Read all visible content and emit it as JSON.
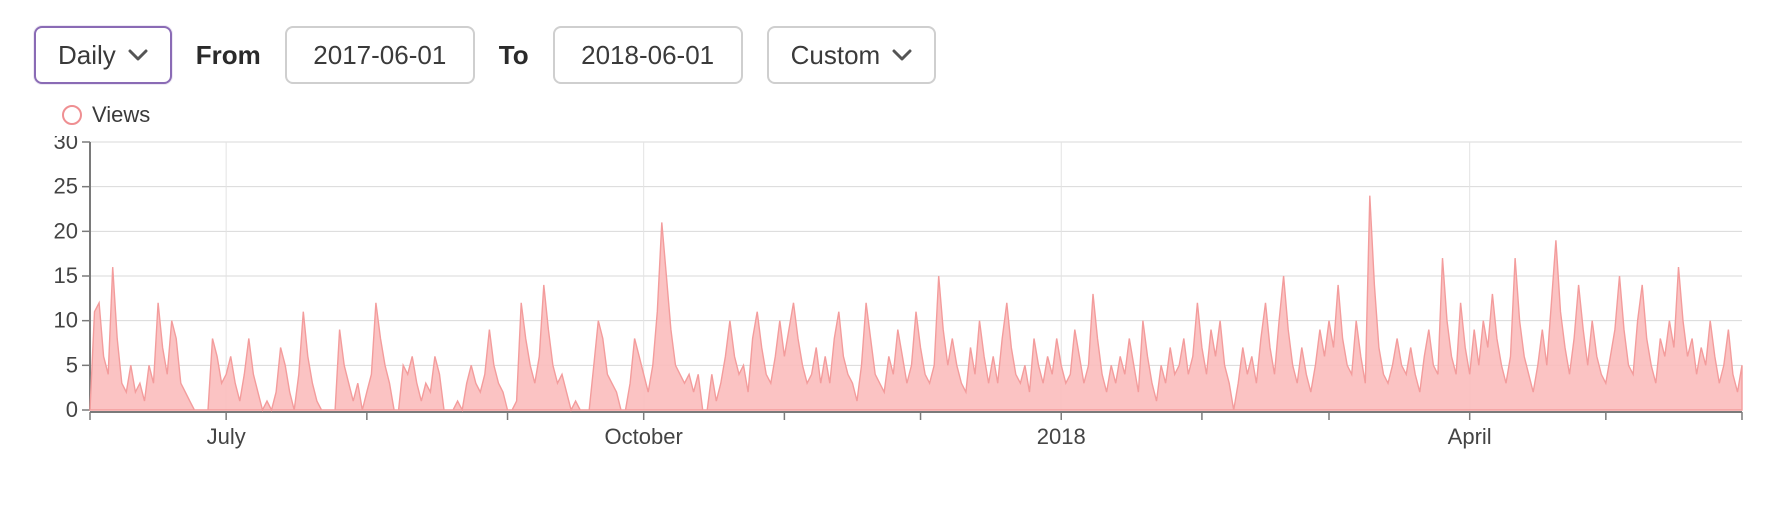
{
  "toolbar": {
    "granularity": "Daily",
    "from_label": "From",
    "from_value": "2017-06-01",
    "to_label": "To",
    "to_value": "2018-06-01",
    "range_preset": "Custom"
  },
  "legend": {
    "series_label": "Views"
  },
  "chart_data": {
    "type": "area",
    "title": "",
    "xlabel": "",
    "ylabel": "",
    "ylim": [
      0,
      30
    ],
    "yticks": [
      0,
      5,
      10,
      15,
      20,
      25,
      30
    ],
    "x_tick_labels": [
      "July",
      "October",
      "2018",
      "April"
    ],
    "series": [
      {
        "name": "Views",
        "start_date": "2017-06-01",
        "end_date": "2018-06-01",
        "color": "#fbbdbc",
        "stroke": "#f39c9c",
        "values": [
          0,
          11,
          12,
          6,
          4,
          16,
          8,
          3,
          2,
          5,
          2,
          3,
          1,
          5,
          3,
          12,
          7,
          4,
          10,
          8,
          3,
          2,
          1,
          0,
          0,
          0,
          0,
          8,
          6,
          3,
          4,
          6,
          3,
          1,
          4,
          8,
          4,
          2,
          0,
          1,
          0,
          2,
          7,
          5,
          2,
          0,
          4,
          11,
          6,
          3,
          1,
          0,
          0,
          0,
          0,
          9,
          5,
          3,
          1,
          3,
          0,
          2,
          4,
          12,
          8,
          5,
          3,
          0,
          0,
          5,
          4,
          6,
          3,
          1,
          3,
          2,
          6,
          4,
          0,
          0,
          0,
          1,
          0,
          3,
          5,
          3,
          2,
          4,
          9,
          5,
          3,
          2,
          0,
          0,
          1,
          12,
          8,
          5,
          3,
          6,
          14,
          9,
          5,
          3,
          4,
          2,
          0,
          1,
          0,
          0,
          0,
          5,
          10,
          8,
          4,
          3,
          2,
          0,
          0,
          3,
          8,
          6,
          4,
          2,
          5,
          11,
          21,
          15,
          9,
          5,
          4,
          3,
          4,
          2,
          4,
          0,
          0,
          4,
          1,
          3,
          6,
          10,
          6,
          4,
          5,
          2,
          8,
          11,
          7,
          4,
          3,
          6,
          10,
          6,
          9,
          12,
          8,
          5,
          3,
          4,
          7,
          3,
          6,
          3,
          8,
          11,
          6,
          4,
          3,
          1,
          5,
          12,
          8,
          4,
          3,
          2,
          6,
          4,
          9,
          6,
          3,
          5,
          11,
          7,
          4,
          3,
          5,
          15,
          9,
          5,
          8,
          5,
          3,
          2,
          7,
          4,
          10,
          6,
          3,
          6,
          3,
          8,
          12,
          7,
          4,
          3,
          5,
          2,
          8,
          5,
          3,
          6,
          4,
          8,
          5,
          3,
          4,
          9,
          6,
          3,
          5,
          13,
          8,
          4,
          2,
          5,
          3,
          6,
          4,
          8,
          5,
          2,
          10,
          6,
          3,
          1,
          5,
          3,
          7,
          4,
          5,
          8,
          4,
          6,
          12,
          7,
          4,
          9,
          6,
          10,
          5,
          3,
          0,
          3,
          7,
          4,
          6,
          3,
          8,
          12,
          7,
          4,
          10,
          15,
          9,
          5,
          3,
          7,
          4,
          2,
          5,
          9,
          6,
          10,
          7,
          14,
          8,
          5,
          4,
          10,
          6,
          3,
          24,
          14,
          7,
          4,
          3,
          5,
          8,
          5,
          4,
          7,
          4,
          2,
          6,
          9,
          5,
          4,
          17,
          10,
          6,
          4,
          12,
          7,
          4,
          9,
          5,
          10,
          7,
          13,
          8,
          5,
          3,
          6,
          17,
          10,
          6,
          4,
          2,
          5,
          9,
          5,
          12,
          19,
          11,
          7,
          4,
          8,
          14,
          9,
          5,
          10,
          6,
          4,
          3,
          6,
          9,
          15,
          9,
          5,
          4,
          10,
          14,
          8,
          5,
          3,
          8,
          6,
          10,
          7,
          16,
          10,
          6,
          8,
          4,
          7,
          5,
          10,
          6,
          3,
          5,
          9,
          4,
          2,
          5
        ]
      }
    ]
  }
}
